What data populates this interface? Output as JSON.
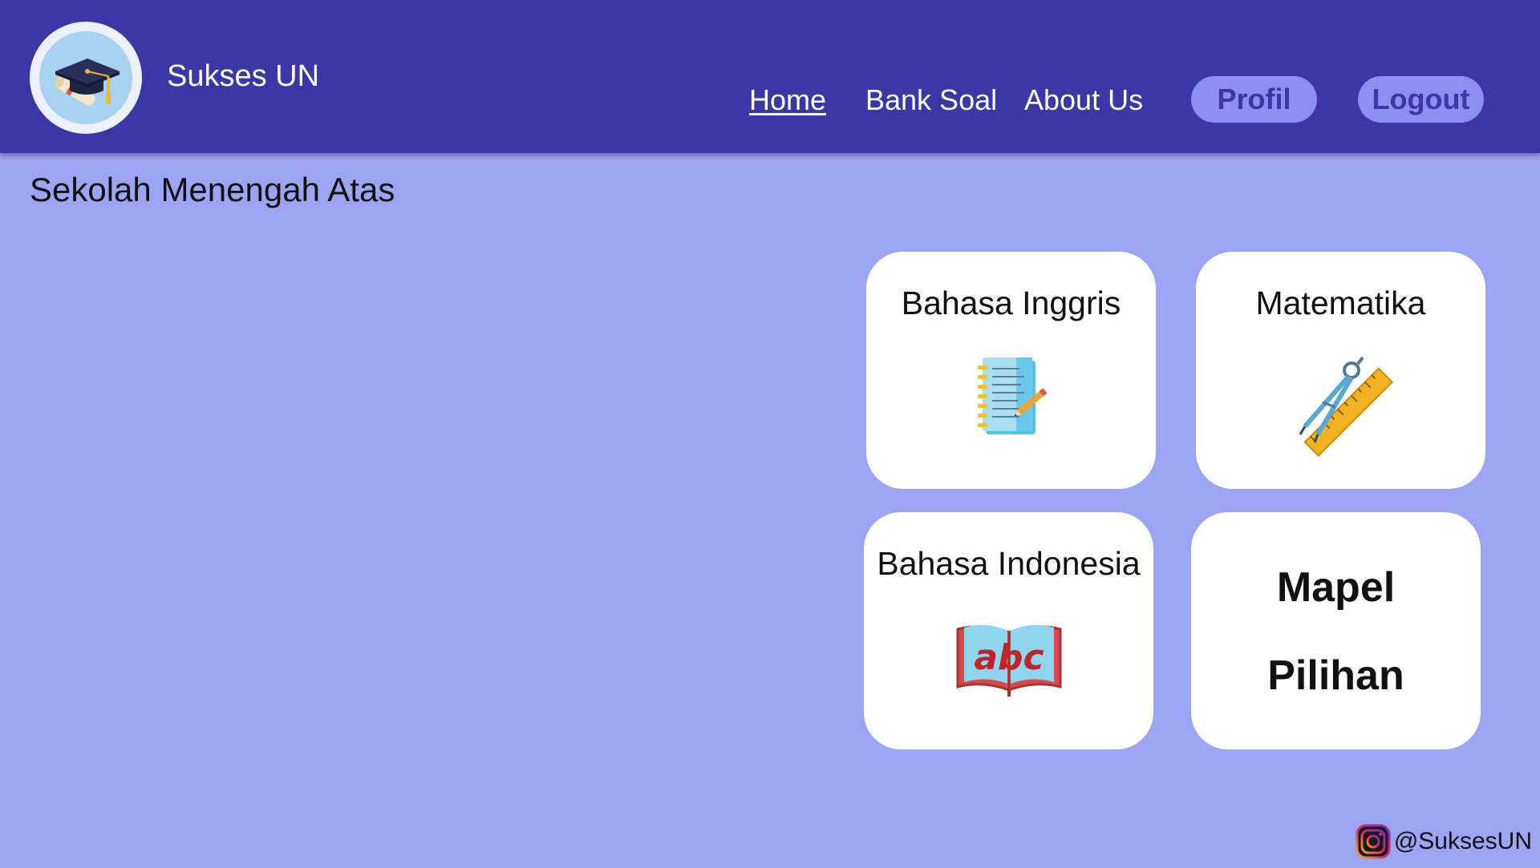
{
  "app": {
    "brand_name": "Sukses UN",
    "logo_icon": "graduation-cap-diploma"
  },
  "nav": {
    "links": [
      {
        "label": "Home",
        "active": true
      },
      {
        "label": "Bank Soal",
        "active": false
      },
      {
        "label": "About Us",
        "active": false
      }
    ],
    "profil_label": "Profil",
    "logout_label": "Logout"
  },
  "page": {
    "section_title": "Sekolah Menengah Atas"
  },
  "subjects": [
    {
      "title": "Bahasa Inggris",
      "icon": "notebook-pencil-icon"
    },
    {
      "title": "Matematika",
      "icon": "compass-ruler-icon"
    },
    {
      "title": "Bahasa Indonesia",
      "icon": "abc-book-icon",
      "icon_text": "abc"
    },
    {
      "title_line1": "Mapel",
      "title_line2": "Pilihan"
    }
  ],
  "footer": {
    "instagram_handle": "@SuksesUN",
    "icon": "instagram-icon"
  },
  "colors": {
    "navbar": "#3c37a7",
    "background": "#9ca5f4",
    "pill": "#8a8ff0",
    "card": "#ffffff"
  }
}
